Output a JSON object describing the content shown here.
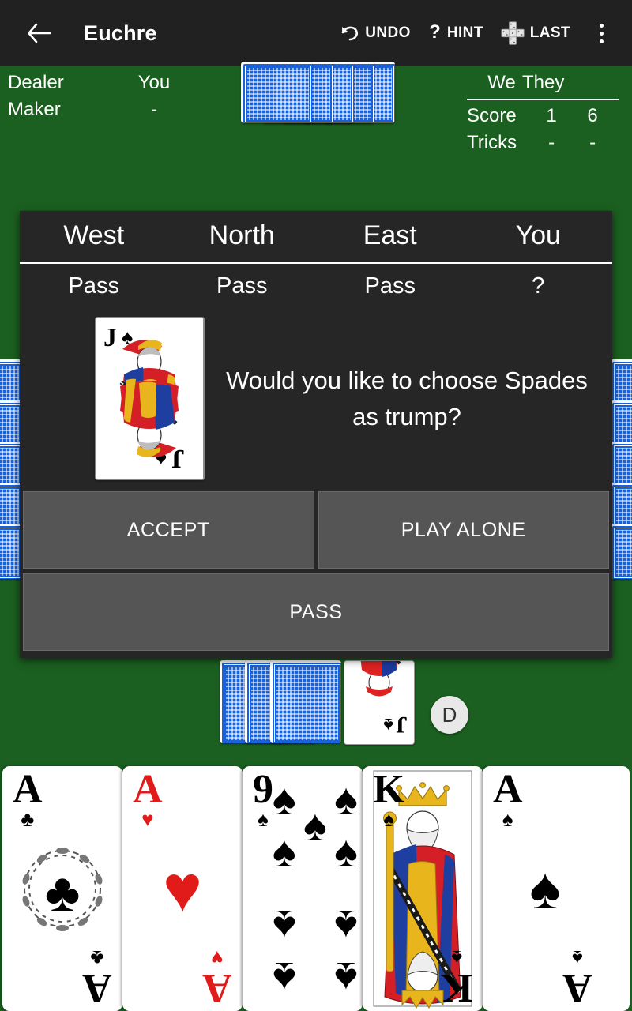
{
  "appbar": {
    "back_icon": "back-arrow-icon",
    "title": "Euchre",
    "actions": [
      {
        "icon": "undo-icon",
        "label": "UNDO"
      },
      {
        "icon": "question-mark-icon",
        "label": "HINT"
      },
      {
        "icon": "last-trick-cards-icon",
        "label": "LAST"
      }
    ],
    "overflow_icon": "more-vertical-icon"
  },
  "table_info": {
    "rows": [
      {
        "key": "Dealer",
        "value": "You"
      },
      {
        "key": "Maker",
        "value": "-"
      }
    ]
  },
  "scoreboard": {
    "columns": [
      "We",
      "They"
    ],
    "rows": [
      {
        "label": "Score",
        "we": "1",
        "they": "6"
      },
      {
        "label": "Tricks",
        "we": "-",
        "they": "-"
      }
    ]
  },
  "dealer_chip": {
    "label": "D"
  },
  "bid_dialog": {
    "players": [
      "West",
      "North",
      "East",
      "You"
    ],
    "bids": [
      "Pass",
      "Pass",
      "Pass",
      "?"
    ],
    "trump_card": {
      "rank": "J",
      "suit": "spades",
      "suit_symbol": "♠",
      "color": "#000000"
    },
    "question": "Would you like to choose Spades as trump?",
    "buttons": {
      "accept": "ACCEPT",
      "play_alone": "PLAY ALONE",
      "pass": "PASS"
    }
  },
  "player_hand": {
    "cards": [
      {
        "rank": "A",
        "suit": "clubs",
        "suit_symbol": "♣",
        "color": "#000000"
      },
      {
        "rank": "A",
        "suit": "hearts",
        "suit_symbol": "♥",
        "color": "#e01b19"
      },
      {
        "rank": "9",
        "suit": "spades",
        "suit_symbol": "♠",
        "color": "#000000"
      },
      {
        "rank": "K",
        "suit": "spades",
        "suit_symbol": "♠",
        "color": "#000000"
      },
      {
        "rank": "A",
        "suit": "spades",
        "suit_symbol": "♠",
        "color": "#000000"
      }
    ]
  },
  "colors": {
    "table_green": "#1b6020",
    "appbar": "#212121",
    "dialog_bg": "#262626",
    "button_bg": "#555555",
    "card_back_blue": "#1763df"
  }
}
